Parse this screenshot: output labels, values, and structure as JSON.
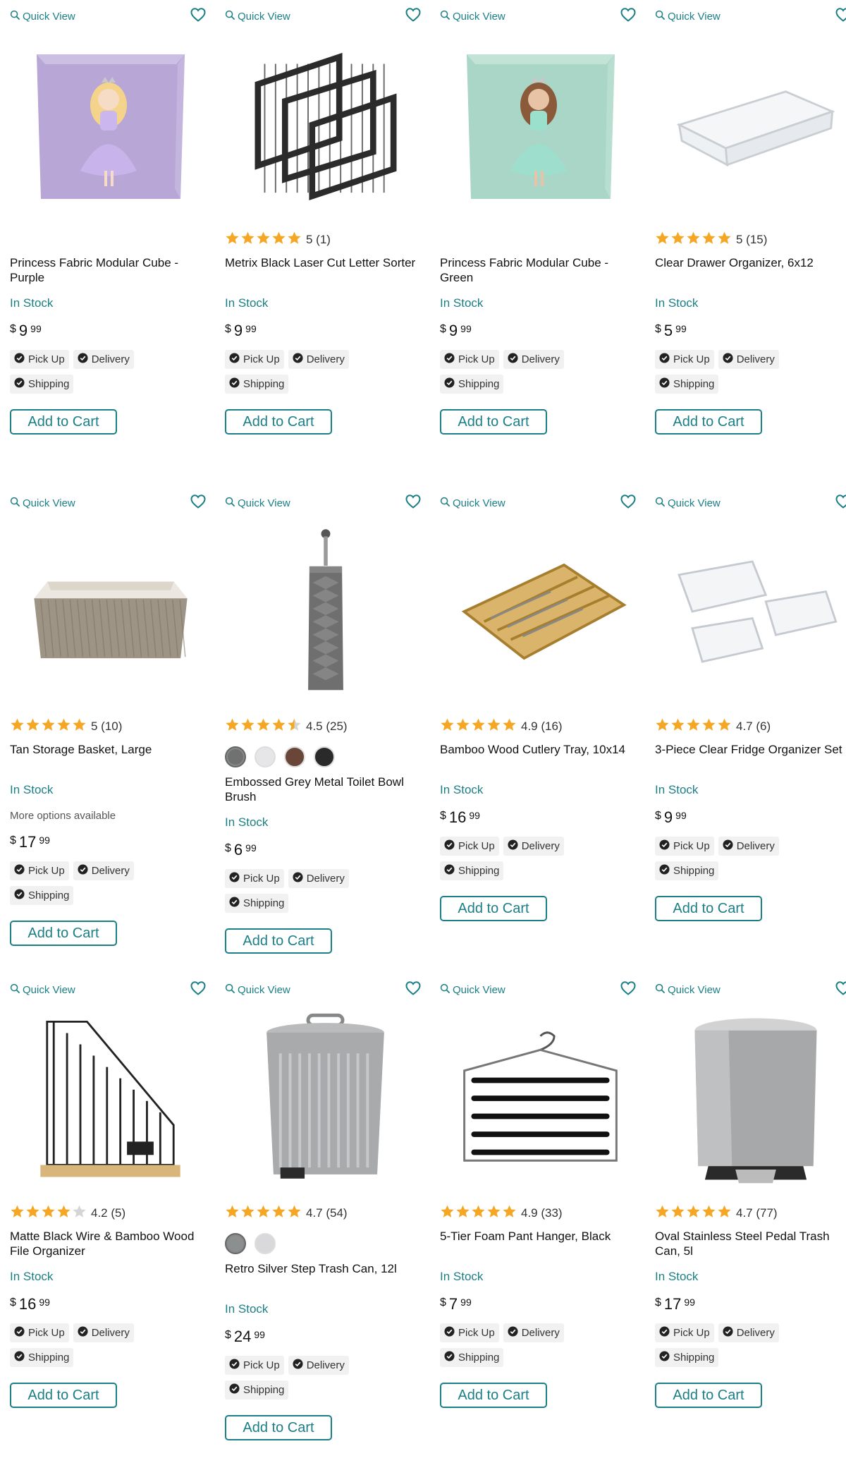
{
  "common": {
    "quick_view": "Quick View",
    "in_stock": "In Stock",
    "pick_up": "Pick Up",
    "delivery": "Delivery",
    "shipping": "Shipping",
    "add_to_cart": "Add to Cart",
    "currency": "$",
    "accent_color": "#1b7f86",
    "star_color": "#f5a623"
  },
  "products": [
    {
      "title": "Princess Fabric Modular Cube - Purple",
      "price_dollars": "9",
      "price_cents": "99",
      "image_icon": "purple-princess-cube-image"
    },
    {
      "title": "Metrix Black Laser Cut Letter Sorter",
      "stars": 5,
      "rating_text": "5 (1)",
      "price_dollars": "9",
      "price_cents": "99",
      "image_icon": "letter-sorter-image"
    },
    {
      "title": "Princess Fabric Modular Cube - Green",
      "price_dollars": "9",
      "price_cents": "99",
      "image_icon": "green-princess-cube-image"
    },
    {
      "title": "Clear Drawer Organizer, 6x12",
      "stars": 5,
      "rating_text": "5 (15)",
      "price_dollars": "5",
      "price_cents": "99",
      "image_icon": "clear-drawer-organizer-image"
    },
    {
      "title": "Tan Storage Basket, Large",
      "stars": 5,
      "rating_text": "5 (10)",
      "more_options": "More options available",
      "price_dollars": "17",
      "price_cents": "99",
      "image_icon": "storage-basket-image"
    },
    {
      "title": "Embossed Grey Metal Toilet Bowl Brush",
      "stars": 4.5,
      "rating_text": "4.5 (25)",
      "swatches": [
        "#707272",
        "#e6e6e8",
        "#6a4638",
        "#2a2a2a"
      ],
      "price_dollars": "6",
      "price_cents": "99",
      "image_icon": "toilet-brush-image"
    },
    {
      "title": "Bamboo Wood Cutlery Tray, 10x14",
      "stars": 5,
      "rating_text": "4.9 (16)",
      "price_dollars": "16",
      "price_cents": "99",
      "image_icon": "cutlery-tray-image"
    },
    {
      "title": "3-Piece Clear Fridge Organizer Set",
      "stars": 5,
      "rating_text": "4.7 (6)",
      "price_dollars": "9",
      "price_cents": "99",
      "image_icon": "fridge-organizer-image"
    },
    {
      "title": "Matte Black Wire & Bamboo Wood File Organizer",
      "stars": 4,
      "rating_text": "4.2 (5)",
      "price_dollars": "16",
      "price_cents": "99",
      "image_icon": "file-organizer-image"
    },
    {
      "title": "Retro Silver Step Trash Can, 12l",
      "stars": 5,
      "rating_text": "4.7 (54)",
      "swatches": [
        "#8c8f90",
        "#d9d9db"
      ],
      "price_dollars": "24",
      "price_cents": "99",
      "image_icon": "step-trash-can-image"
    },
    {
      "title": "5-Tier Foam Pant Hanger, Black",
      "stars": 5,
      "rating_text": "4.9 (33)",
      "price_dollars": "7",
      "price_cents": "99",
      "image_icon": "pant-hanger-image"
    },
    {
      "title": "Oval Stainless Steel Pedal Trash Can, 5l",
      "stars": 5,
      "rating_text": "4.7 (77)",
      "price_dollars": "17",
      "price_cents": "99",
      "image_icon": "pedal-trash-can-image"
    }
  ]
}
